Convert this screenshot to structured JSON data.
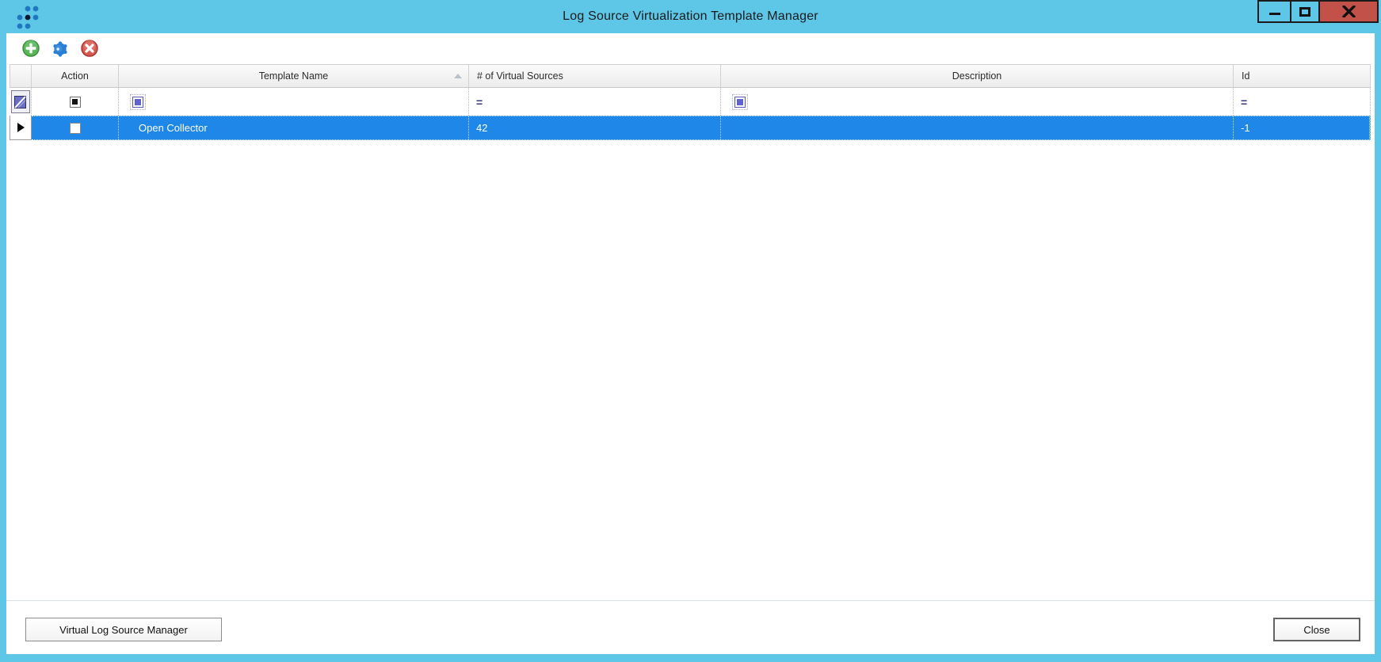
{
  "window": {
    "title": "Log Source Virtualization Template Manager",
    "controls": [
      {
        "name": "minimize"
      },
      {
        "name": "maximize"
      },
      {
        "name": "close"
      }
    ]
  },
  "toolbar": {
    "buttons": [
      {
        "name": "add",
        "color": "#4ea84e"
      },
      {
        "name": "properties",
        "color": "#2a7fd4"
      },
      {
        "name": "delete",
        "color": "#d0473f"
      }
    ]
  },
  "grid": {
    "columns": [
      "Action",
      "Template Name",
      "# of Virtual Sources",
      "Description",
      "Id"
    ],
    "sorted_column": "Template Name",
    "sort_direction": "ascending",
    "filter_row": {
      "equals_operator": "="
    },
    "rows": [
      {
        "action_checked": false,
        "template_name": "Open Collector",
        "num_virtual_sources": "42",
        "description": "",
        "id": "-1",
        "selected": true
      }
    ]
  },
  "footer": {
    "manager_button": "Virtual Log Source Manager",
    "close_button": "Close"
  },
  "colors": {
    "titlebar": "#5ec7e8",
    "close_button_bg": "#c25249",
    "selected_row": "#1f87e8"
  }
}
